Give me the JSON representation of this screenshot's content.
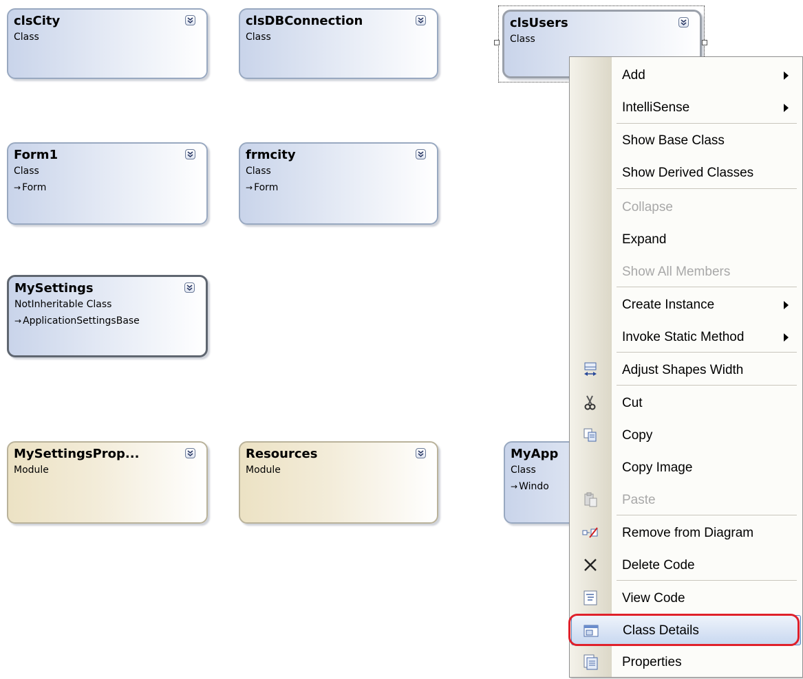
{
  "diagram": {
    "shapes": [
      {
        "id": "clsCity",
        "name": "clsCity",
        "kind": "Class",
        "base": ""
      },
      {
        "id": "clsDBConnection",
        "name": "clsDBConnection",
        "kind": "Class",
        "base": ""
      },
      {
        "id": "clsUsers",
        "name": "clsUsers",
        "kind": "Class",
        "base": ""
      },
      {
        "id": "Form1",
        "name": "Form1",
        "kind": "Class",
        "base": "Form"
      },
      {
        "id": "frmcity",
        "name": "frmcity",
        "kind": "Class",
        "base": "Form"
      },
      {
        "id": "MySettings",
        "name": "MySettings",
        "kind": "NotInheritable Class",
        "base": "ApplicationSettingsBase"
      },
      {
        "id": "MySettingsProperty",
        "name": "MySettingsProp...",
        "kind": "Module",
        "base": ""
      },
      {
        "id": "Resources",
        "name": "Resources",
        "kind": "Module",
        "base": ""
      },
      {
        "id": "MyApp",
        "name": "MyApp",
        "kind": "Class",
        "base": "Windo"
      }
    ],
    "inherit_arrow": "→"
  },
  "context_menu": {
    "items": [
      {
        "label": "Add",
        "submenu": true,
        "enabled": true,
        "icon": ""
      },
      {
        "label": "IntelliSense",
        "submenu": true,
        "enabled": true,
        "icon": ""
      },
      {
        "label": "Show Base Class",
        "submenu": false,
        "enabled": true,
        "icon": ""
      },
      {
        "label": "Show Derived Classes",
        "submenu": false,
        "enabled": true,
        "icon": ""
      },
      {
        "label": "Collapse",
        "submenu": false,
        "enabled": false,
        "icon": ""
      },
      {
        "label": "Expand",
        "submenu": false,
        "enabled": true,
        "icon": ""
      },
      {
        "label": "Show All Members",
        "submenu": false,
        "enabled": false,
        "icon": ""
      },
      {
        "label": "Create Instance",
        "submenu": true,
        "enabled": true,
        "icon": ""
      },
      {
        "label": "Invoke Static Method",
        "submenu": true,
        "enabled": true,
        "icon": ""
      },
      {
        "label": "Adjust Shapes Width",
        "submenu": false,
        "enabled": true,
        "icon": "adjust-width-icon"
      },
      {
        "label": "Cut",
        "submenu": false,
        "enabled": true,
        "icon": "scissors-icon"
      },
      {
        "label": "Copy",
        "submenu": false,
        "enabled": true,
        "icon": "copy-icon"
      },
      {
        "label": "Copy Image",
        "submenu": false,
        "enabled": true,
        "icon": ""
      },
      {
        "label": "Paste",
        "submenu": false,
        "enabled": false,
        "icon": "paste-icon"
      },
      {
        "label": "Remove from Diagram",
        "submenu": false,
        "enabled": true,
        "icon": "remove-from-diagram-icon"
      },
      {
        "label": "Delete Code",
        "submenu": false,
        "enabled": true,
        "icon": "delete-x-icon"
      },
      {
        "label": "View Code",
        "submenu": false,
        "enabled": true,
        "icon": "view-code-icon"
      },
      {
        "label": "Class Details",
        "submenu": false,
        "enabled": true,
        "highlighted": true,
        "icon": "class-details-icon"
      },
      {
        "label": "Properties",
        "submenu": false,
        "enabled": true,
        "icon": "properties-icon"
      }
    ]
  },
  "colors": {
    "class_fill": "#c9d4ea",
    "module_fill": "#ece2c4",
    "highlight_ring": "#e0202a",
    "disabled_text": "#a8a8a8"
  }
}
